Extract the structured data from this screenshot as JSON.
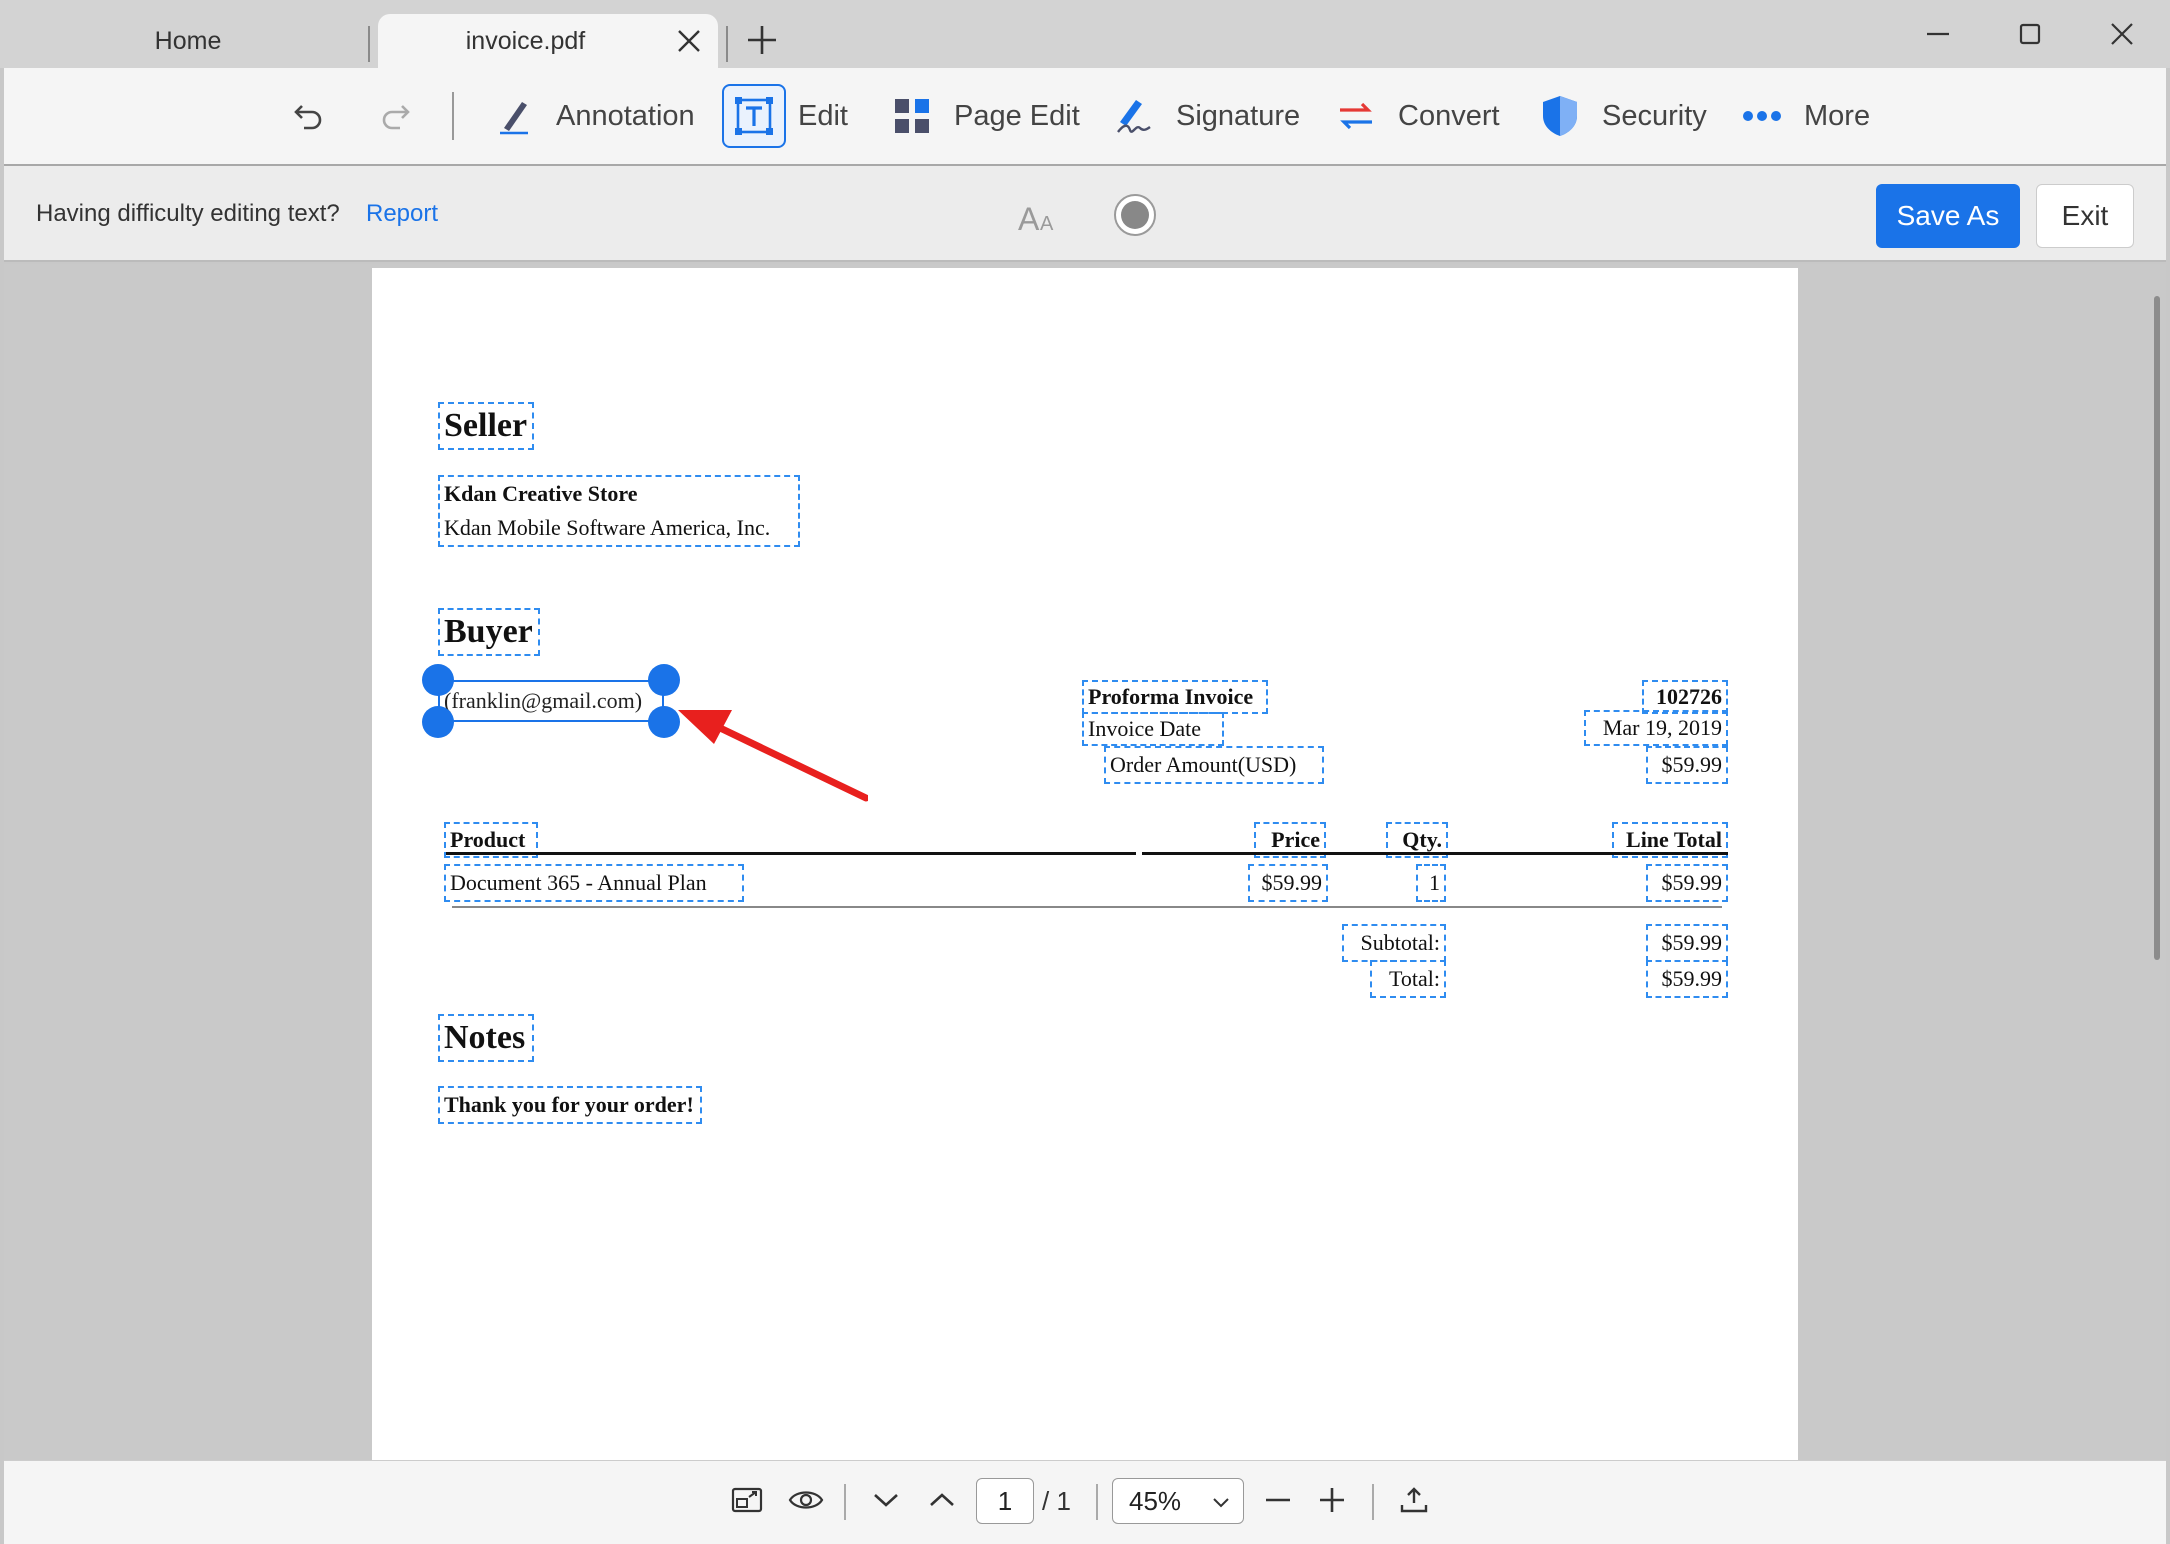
{
  "tabs": [
    {
      "label": "Home"
    },
    {
      "label": "invoice.pdf"
    }
  ],
  "toolbar": {
    "annotation": "Annotation",
    "edit": "Edit",
    "page_edit": "Page Edit",
    "signature": "Signature",
    "convert": "Convert",
    "security": "Security",
    "more": "More"
  },
  "infobar": {
    "message": "Having difficulty editing text?",
    "report": "Report",
    "font_size_icon": "Aᴀ",
    "save_as": "Save As",
    "exit": "Exit"
  },
  "document": {
    "seller_heading": "Seller",
    "seller_name": "Kdan Creative Store",
    "seller_company": "Kdan Mobile Software America, Inc.",
    "buyer_heading": "Buyer",
    "buyer_email": "(franklin@gmail.com)",
    "invoice_label": "Proforma Invoice",
    "invoice_number": "102726",
    "invoice_date_label": "Invoice Date",
    "invoice_date": "Mar 19, 2019",
    "order_amount_label": "Order Amount(USD)",
    "order_amount": "$59.99",
    "table": {
      "headers": [
        "Product",
        "Price",
        "Qty.",
        "Line Total"
      ],
      "rows": [
        {
          "product": "Document 365 - Annual Plan",
          "price": "$59.99",
          "qty": "1",
          "line_total": "$59.99"
        }
      ]
    },
    "subtotal_label": "Subtotal:",
    "subtotal": "$59.99",
    "total_label": "Total:",
    "total": "$59.99",
    "notes_heading": "Notes",
    "notes_text": "Thank you for your order!"
  },
  "bottombar": {
    "current_page": "1",
    "total_pages": "/ 1",
    "zoom": "45%"
  },
  "colors": {
    "accent": "#1a73e8",
    "arrow": "#e8201e"
  }
}
